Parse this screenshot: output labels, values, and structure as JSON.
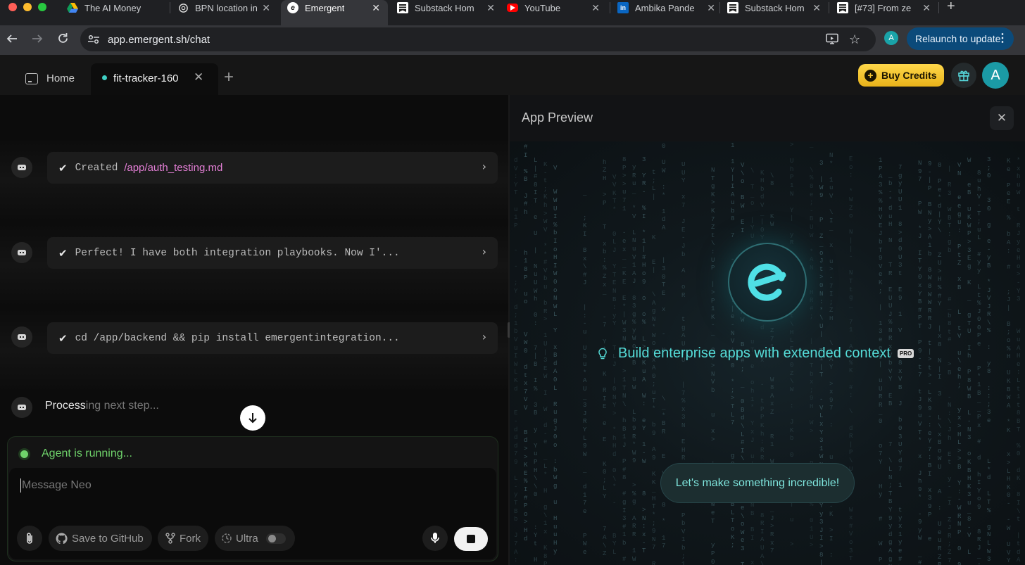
{
  "browser": {
    "tabs": [
      {
        "title": "The AI Money",
        "icon": "google-drive-icon"
      },
      {
        "title": "BPN location in",
        "icon": "openai-icon"
      },
      {
        "title": "Emergent",
        "icon": "emergent-icon"
      },
      {
        "title": "Substack Hom",
        "icon": "substack-icon"
      },
      {
        "title": "YouTube",
        "icon": "youtube-icon"
      },
      {
        "title": "Ambika Pande",
        "icon": "linkedin-icon"
      },
      {
        "title": "Substack Hom",
        "icon": "substack-icon"
      },
      {
        "title": "[#73] From ze",
        "icon": "substack-icon"
      }
    ],
    "url": "app.emergent.sh/chat",
    "profile_initial": "A",
    "relaunch_label": "Relaunch to update"
  },
  "app": {
    "home_tab": "Home",
    "project_tab": "fit-tracker-160",
    "buy_credits": "Buy Credits",
    "avatar_initial": "A"
  },
  "chat": {
    "messages": [
      {
        "prefix": "Created ",
        "path": "/app/auth_testing.md"
      },
      {
        "text": "Perfect! I have both integration playbooks. Now I'..."
      },
      {
        "text": "cd /app/backend && pip install emergentintegration..."
      }
    ],
    "processing_bright": "Process",
    "processing_dim": "ing next step...",
    "status": "Agent is running...",
    "input_placeholder": "Message Neo",
    "save_github": "Save to GitHub",
    "fork": "Fork",
    "ultra": "Ultra"
  },
  "preview": {
    "title": "App Preview",
    "tagline": "Build enterprise apps with extended context",
    "pro_badge": "PRO",
    "cta": "Let's make something incredible!"
  },
  "colors": {
    "accent_teal": "#4fd6d6",
    "path_pink": "#e47fd6",
    "status_green": "#6fd36b",
    "buy_yellow": "#f5c533",
    "relaunch_blue": "#0b4a7a"
  }
}
